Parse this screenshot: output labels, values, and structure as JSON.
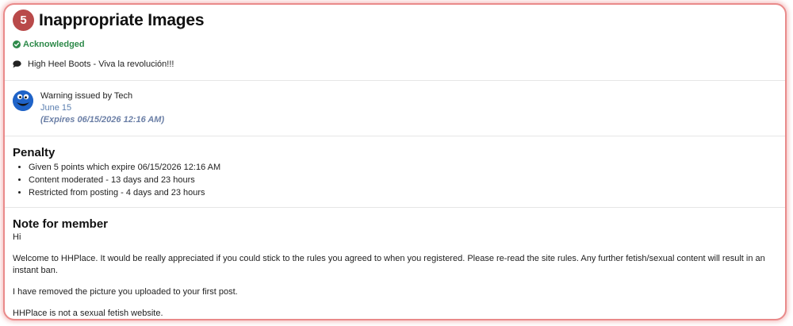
{
  "warning": {
    "points": "5",
    "title": "Inappropriate Images",
    "status": "Acknowledged",
    "thread": "High Heel Boots - Viva la revolución!!!"
  },
  "issuer": {
    "issued_by": "Warning issued by Tech",
    "date": "June 15",
    "expires": "(Expires 06/15/2026 12:16 AM)"
  },
  "penalty": {
    "heading": "Penalty",
    "items": [
      "Given 5 points which expire 06/15/2026 12:16 AM",
      "Content moderated - 13 days and 23 hours",
      "Restricted from posting - 4 days and 23 hours"
    ]
  },
  "note": {
    "heading": "Note for member",
    "paragraphs": [
      "Hi",
      "Welcome to HHPlace. It would be really appreciated if you could stick to the rules you agreed to when you registered. Please re-read the site rules. Any further fetish/sexual content will result in an instant ban.",
      "I have removed the picture you uploaded to your first post.",
      "HHPlace is not a sexual fetish website."
    ]
  }
}
